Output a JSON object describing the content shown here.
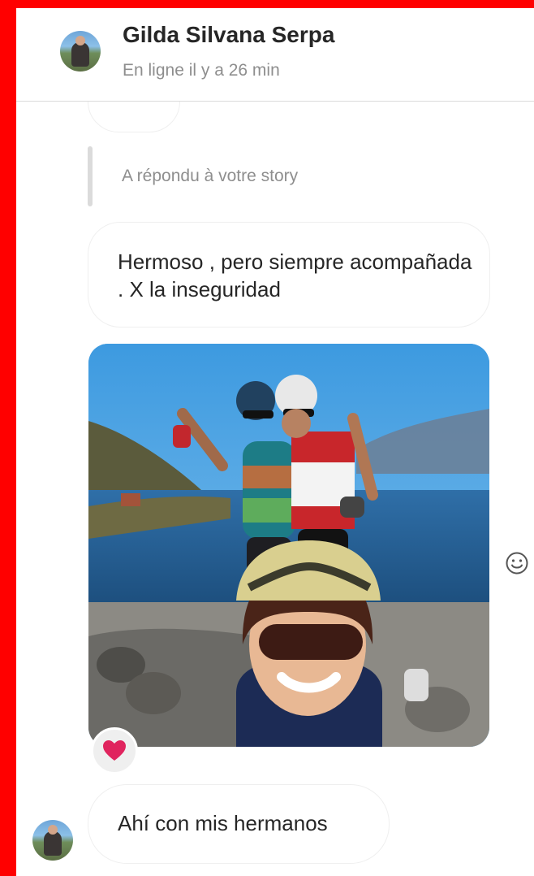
{
  "header": {
    "contact_name": "Gilda Silvana Serpa",
    "status": "En ligne il y a 26 min"
  },
  "thread": {
    "reply_label": "A répondu à votre story",
    "messages": [
      {
        "text": "Hermoso , pero siempre acompañada . X la inseguridad"
      },
      {
        "text": "Ahí con mis hermanos"
      }
    ],
    "photo": {
      "reaction": "heart"
    }
  },
  "colors": {
    "frame_border": "#ff0000",
    "heart": "#e0245e",
    "secondary_text": "#8e8e8e",
    "primary_text": "#262626"
  }
}
